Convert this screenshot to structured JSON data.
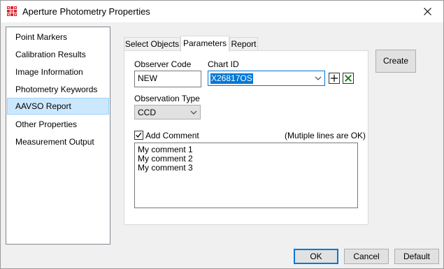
{
  "window": {
    "title": "Aperture Photometry Properties"
  },
  "sidebar": {
    "items": [
      {
        "label": "Point Markers"
      },
      {
        "label": "Calibration Results"
      },
      {
        "label": "Image Information"
      },
      {
        "label": "Photometry Keywords"
      },
      {
        "label": "AAVSO Report",
        "selected": true
      },
      {
        "label": "Other Properties"
      },
      {
        "label": "Measurement Output"
      }
    ]
  },
  "tabs": [
    {
      "label": "Select Objects"
    },
    {
      "label": "Parameters",
      "active": true
    },
    {
      "label": "Report"
    }
  ],
  "parameters": {
    "observer_code_label": "Observer Code",
    "observer_code_value": "NEW",
    "chart_id_label": "Chart ID",
    "chart_id_value": "X26817OS",
    "observation_type_label": "Observation Type",
    "observation_type_value": "CCD",
    "add_comment_label": "Add Comment",
    "add_comment_checked": true,
    "multiline_hint": "(Mutiple lines are OK)",
    "comment_lines": [
      "My comment 1",
      "My comment 2",
      "My comment 3"
    ]
  },
  "buttons": {
    "create": "Create",
    "ok": "OK",
    "cancel": "Cancel",
    "default": "Default"
  },
  "icons": {
    "app": "photometry-app-icon",
    "close": "close-icon",
    "add": "plus-icon",
    "delete": "x-box-icon",
    "check": "checkmark-icon",
    "dropdown": "chevron-down-icon"
  },
  "colors": {
    "selection": "#cce8ff",
    "focus": "#0078d7",
    "app_icon": "#d9232d",
    "delete_icon": "#1c7a1c"
  }
}
